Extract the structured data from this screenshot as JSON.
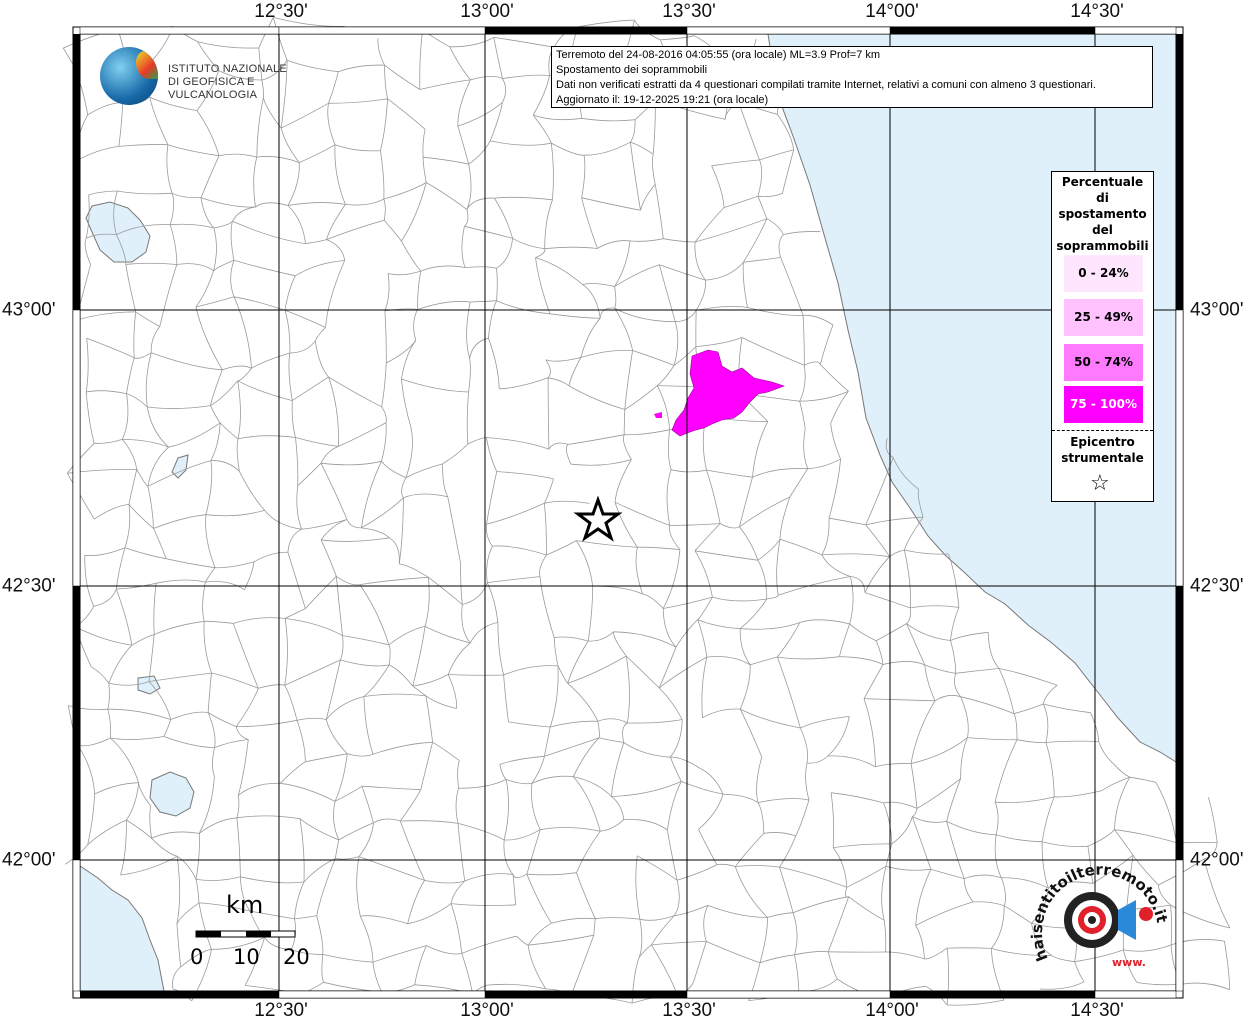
{
  "ticks": {
    "lon": [
      "12°30'",
      "13°00'",
      "13°30'",
      "14°00'",
      "14°30'"
    ],
    "lat": [
      "43°00'",
      "42°30'",
      "42°00'"
    ]
  },
  "header": {
    "line1": "Terremoto del 24-08-2016 04:05:55 (ora locale) ML=3.9 Prof=7 km",
    "line2": "Spostamento dei soprammobili",
    "line3": "Dati non verificati estratti da 4 questionari compilati tramite Internet, relativi a comuni con almeno 3 questionari.",
    "line4": "Aggiornato il: 19-12-2025 19:21 (ora locale)"
  },
  "logo": {
    "line1": "ISTITUTO NAZIONALE",
    "line2": "DI GEOFISICA E VULCANOLOGIA"
  },
  "legend": {
    "title_lines": [
      "Percentuale",
      "di",
      "spostamento",
      "del",
      "soprammobili"
    ],
    "classes": [
      {
        "label": "0 - 24%",
        "color": "#ffe6ff"
      },
      {
        "label": "25 - 49%",
        "color": "#ffc2ff"
      },
      {
        "label": "50 - 74%",
        "color": "#ff7aff"
      },
      {
        "label": "75 - 100%",
        "color": "#ff00ff"
      }
    ],
    "epicenter_lines": [
      "Epicentro",
      "strumentale"
    ],
    "star": "☆"
  },
  "scale": {
    "unit": "km",
    "labels": [
      "0",
      "10",
      "20"
    ]
  },
  "watermark": {
    "text": "haisentitoilterremoto.it",
    "site": "www."
  },
  "colors": {
    "sea": "#dff0fb",
    "border": "#999999",
    "grid": "#000000",
    "highlight": "#ff00ff"
  }
}
